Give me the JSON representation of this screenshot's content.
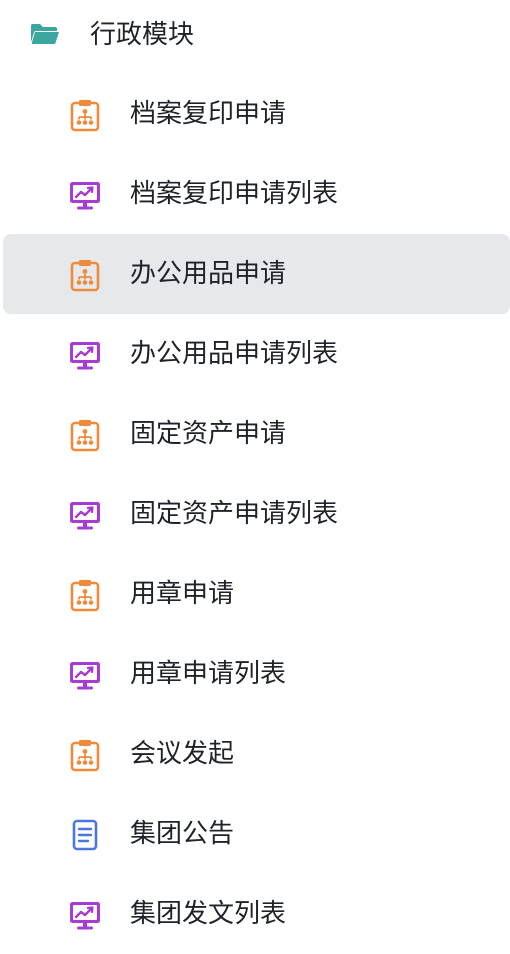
{
  "group": {
    "label": "行政模块",
    "icon": "folder-open-icon",
    "icon_color": "#3ba5a0"
  },
  "colors": {
    "form": "#ef8a3b",
    "list": "#a63bd6",
    "doc": "#4a78e0",
    "selected_bg": "#e6e8ec",
    "text": "#1f2329"
  },
  "items": [
    {
      "label": "档案复印申请",
      "icon": "form-clipboard-icon",
      "selected": false
    },
    {
      "label": "档案复印申请列表",
      "icon": "chart-monitor-icon",
      "selected": false
    },
    {
      "label": "办公用品申请",
      "icon": "form-clipboard-icon",
      "selected": true
    },
    {
      "label": "办公用品申请列表",
      "icon": "chart-monitor-icon",
      "selected": false
    },
    {
      "label": "固定资产申请",
      "icon": "form-clipboard-icon",
      "selected": false
    },
    {
      "label": "固定资产申请列表",
      "icon": "chart-monitor-icon",
      "selected": false
    },
    {
      "label": "用章申请",
      "icon": "form-clipboard-icon",
      "selected": false
    },
    {
      "label": "用章申请列表",
      "icon": "chart-monitor-icon",
      "selected": false
    },
    {
      "label": "会议发起",
      "icon": "form-clipboard-icon",
      "selected": false
    },
    {
      "label": "集团公告",
      "icon": "document-icon",
      "selected": false
    },
    {
      "label": "集团发文列表",
      "icon": "chart-monitor-icon",
      "selected": false
    }
  ]
}
